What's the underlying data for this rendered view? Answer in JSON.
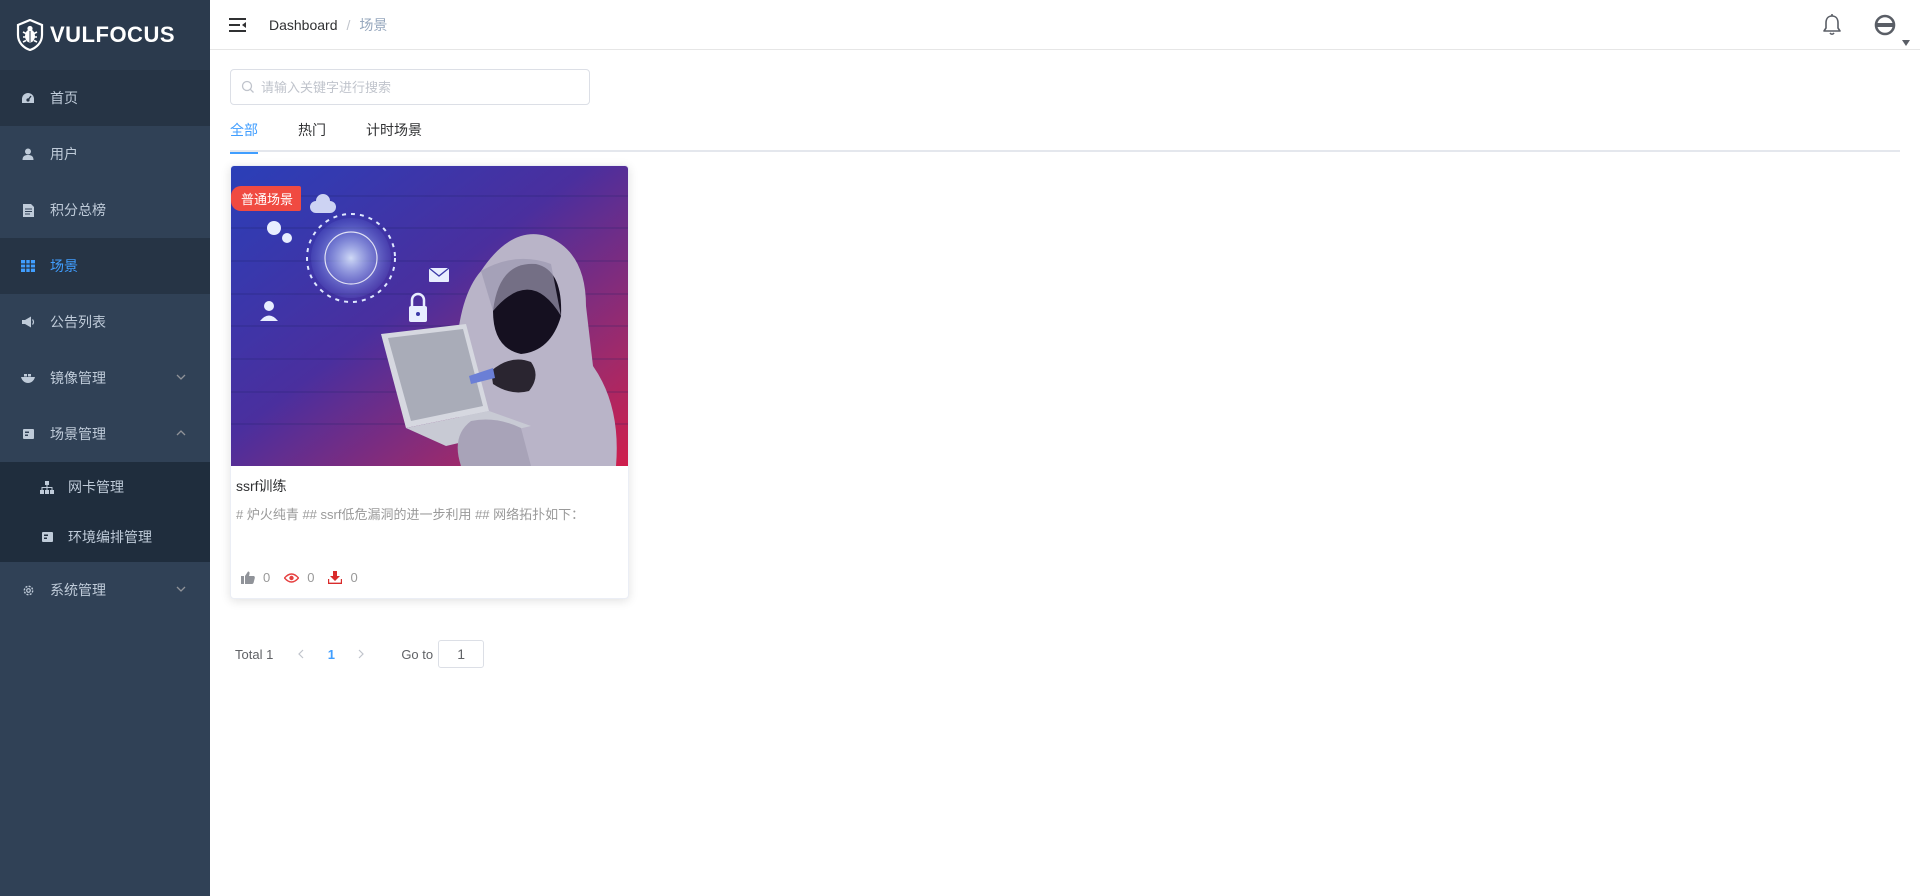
{
  "app": {
    "logo_text": "VULFOCUS"
  },
  "colors": {
    "sidebar_bg": "#304156",
    "accent": "#409eff",
    "tag_red": "#f04a41"
  },
  "sidebar": {
    "items": [
      {
        "label": "首页",
        "icon": "dashboard-icon"
      },
      {
        "label": "用户",
        "icon": "user-icon"
      },
      {
        "label": "积分总榜",
        "icon": "document-icon"
      },
      {
        "label": "场景",
        "icon": "grid-icon",
        "active": true
      },
      {
        "label": "公告列表",
        "icon": "megaphone-icon"
      },
      {
        "label": "镜像管理",
        "icon": "image-icon",
        "has_children": true,
        "expanded": false
      },
      {
        "label": "场景管理",
        "icon": "scene-icon",
        "has_children": true,
        "expanded": true,
        "children": [
          {
            "label": "网卡管理",
            "icon": "network-icon"
          },
          {
            "label": "环境编排管理",
            "icon": "layout-icon"
          }
        ]
      },
      {
        "label": "系统管理",
        "icon": "gear-icon",
        "has_children": true,
        "expanded": false
      }
    ]
  },
  "header": {
    "breadcrumb": {
      "home": "Dashboard",
      "separator": "/",
      "current": "场景"
    }
  },
  "main": {
    "search": {
      "placeholder": "请输入关键字进行搜索",
      "value": ""
    },
    "tabs": [
      {
        "label": "全部",
        "active": true
      },
      {
        "label": "热门",
        "active": false
      },
      {
        "label": "计时场景",
        "active": false
      }
    ],
    "cards": [
      {
        "tag": "普通场景",
        "title": "ssrf训练",
        "description": "# 炉火纯青 ## ssrf低危漏洞的进一步利用 ## 网络拓扑如下：",
        "likes": "0",
        "views": "0",
        "downloads": "0"
      }
    ],
    "pagination": {
      "total": "Total 1",
      "current_page": "1",
      "goto_label": "Go to",
      "goto_value": "1"
    }
  }
}
